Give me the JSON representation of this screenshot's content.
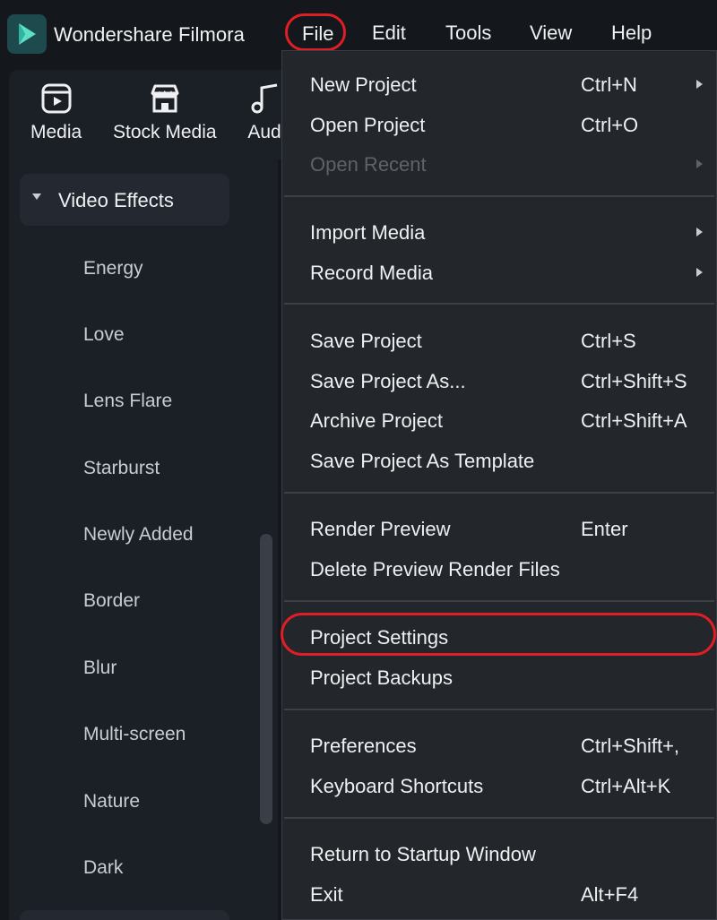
{
  "app": {
    "name": "Wondershare Filmora"
  },
  "menubar": {
    "items": [
      "File",
      "Edit",
      "Tools",
      "View",
      "Help"
    ]
  },
  "toolbar": {
    "items": [
      "Media",
      "Stock Media",
      "Aud"
    ]
  },
  "sidebar": {
    "group_label": "Video Effects",
    "items": [
      "Energy",
      "Love",
      "Lens Flare",
      "Starburst",
      "Newly Added",
      "Border",
      "Blur",
      "Multi-screen",
      "Nature",
      "Dark"
    ]
  },
  "file_menu": {
    "new_project": {
      "label": "New Project",
      "shortcut": "Ctrl+N"
    },
    "open_project": {
      "label": "Open Project",
      "shortcut": "Ctrl+O"
    },
    "open_recent": {
      "label": "Open Recent"
    },
    "import_media": {
      "label": "Import Media"
    },
    "record_media": {
      "label": "Record Media"
    },
    "save_project": {
      "label": "Save Project",
      "shortcut": "Ctrl+S"
    },
    "save_project_as": {
      "label": "Save Project As...",
      "shortcut": "Ctrl+Shift+S"
    },
    "archive_project": {
      "label": "Archive Project",
      "shortcut": "Ctrl+Shift+A"
    },
    "save_as_template": {
      "label": "Save Project As Template"
    },
    "render_preview": {
      "label": "Render Preview",
      "shortcut": "Enter"
    },
    "delete_preview": {
      "label": "Delete Preview Render Files"
    },
    "project_settings": {
      "label": "Project Settings"
    },
    "project_backups": {
      "label": "Project Backups"
    },
    "preferences": {
      "label": "Preferences",
      "shortcut": "Ctrl+Shift+,"
    },
    "keyboard_shortcuts": {
      "label": "Keyboard Shortcuts",
      "shortcut": "Ctrl+Alt+K"
    },
    "return_startup": {
      "label": "Return to Startup Window"
    },
    "exit": {
      "label": "Exit",
      "shortcut": "Alt+F4"
    }
  },
  "colors": {
    "highlight": "#e01e25",
    "menu_bg": "#23262b",
    "app_bg": "#14171c"
  }
}
